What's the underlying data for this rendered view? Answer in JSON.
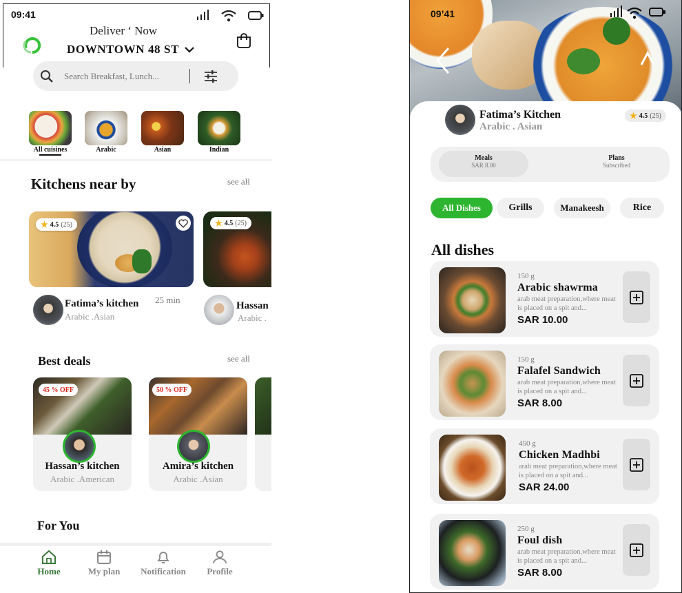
{
  "left": {
    "status": {
      "time": "09:41"
    },
    "header": {
      "deliver_label": "Deliver ‘ Now",
      "location": "DOWNTOWN  48 ST"
    },
    "search": {
      "placeholder": "Search Breakfast, Lunch..."
    },
    "categories": [
      {
        "label": "All cuisines"
      },
      {
        "label": "Arabic"
      },
      {
        "label": "Asian"
      },
      {
        "label": "Indian"
      }
    ],
    "kitchens_near": {
      "title": "Kitchens near by",
      "see_all": "see all",
      "cards": [
        {
          "rating": "4.5",
          "count": "(25)",
          "name": "Fatima’s kitchen",
          "cuisine": "Arabic .Asian",
          "time": "25 min"
        },
        {
          "rating": "4.5",
          "count": "(25)",
          "name": "Hassan",
          "cuisine": "Arabic ."
        }
      ]
    },
    "best_deals": {
      "title": "Best  deals",
      "see_all": "see all",
      "cards": [
        {
          "badge": "45 % OFF",
          "name": "Hassan’s kitchen",
          "cuisine": "Arabic .American"
        },
        {
          "badge": "50 % OFF",
          "name": "Amira’s kitchen",
          "cuisine": "Arabic .Asian"
        }
      ]
    },
    "for_you": {
      "title": "For You"
    },
    "nav": [
      {
        "label": "Home",
        "icon": "home-icon",
        "active": true
      },
      {
        "label": "My plan",
        "icon": "calendar-icon"
      },
      {
        "label": "Notification",
        "icon": "bell-icon"
      },
      {
        "label": "Profile",
        "icon": "user-icon"
      }
    ],
    "colors": {
      "accent": "#2db52f",
      "nav_active": "#3a7a3a"
    }
  },
  "right": {
    "status": {
      "time": "09’41"
    },
    "kitchen": {
      "name": "Fatima’s Kitchen",
      "cuisine": "Arabic . Asian",
      "rating": "4.5",
      "count": "(25)"
    },
    "segments": [
      {
        "title": "Meals",
        "sub": "SAR 8.00"
      },
      {
        "title": "Plans",
        "sub": "Subscribed"
      }
    ],
    "chips": [
      "All Dishes",
      "Grills",
      "Manakeesh",
      "Rice"
    ],
    "section_title": "All dishes",
    "dishes": [
      {
        "weight": "150 g",
        "name": "Arabic shawrma",
        "desc": "arab meat preparation,where meat is placed on a spit and...",
        "price": "SAR 10.00"
      },
      {
        "weight": "150 g",
        "name": "Falafel Sandwich",
        "desc": "arab meat preparation,where meat is placed on a spit and...",
        "price": "SAR 8.00"
      },
      {
        "weight": "450 g",
        "name": "Chicken Madhbi",
        "desc": "arab meat preparation,where meat is placed on a spit and...",
        "price": "SAR 24.00"
      },
      {
        "weight": "250 g",
        "name": "Foul dish",
        "desc": "arab meat preparation,where meat is placed on a spit and...",
        "price": "SAR 8.00"
      }
    ],
    "colors": {
      "accent": "#2db52f"
    }
  }
}
